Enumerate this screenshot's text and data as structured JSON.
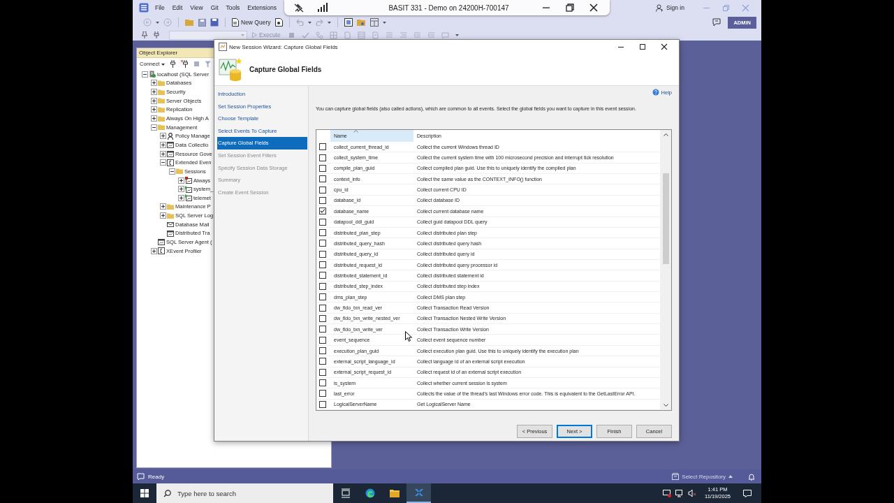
{
  "remote_bar": {
    "title": "BASIT 331 - Demo on 24200H-700147"
  },
  "menu_bar": {
    "items": [
      "File",
      "Edit",
      "View",
      "Git",
      "Tools",
      "Extensions"
    ],
    "sign_in": "Sign in"
  },
  "toolbar": {
    "new_query": "New Query",
    "execute": {
      "label": "Execute",
      "disabled": true
    },
    "account_badge": "ADMIN"
  },
  "object_explorer": {
    "title": "Object Explorer",
    "connect": "Connect",
    "tree": [
      {
        "label": "localhost (SQL Server",
        "kind": "server",
        "expanded": true,
        "children": [
          {
            "label": "Databases",
            "kind": "folder",
            "expanded": false
          },
          {
            "label": "Security",
            "kind": "folder",
            "expanded": false
          },
          {
            "label": "Server Objects",
            "kind": "folder",
            "expanded": false
          },
          {
            "label": "Replication",
            "kind": "folder",
            "expanded": false
          },
          {
            "label": "Always On High A",
            "kind": "folder",
            "expanded": false
          },
          {
            "label": "Management",
            "kind": "folder",
            "expanded": true,
            "children": [
              {
                "label": "Policy Manage",
                "kind": "policy",
                "expanded": false
              },
              {
                "label": "Data Collectio",
                "kind": "window",
                "expanded": false
              },
              {
                "label": "Resource Gove",
                "kind": "window",
                "expanded": false
              },
              {
                "label": "Extended Even",
                "kind": "bracket",
                "expanded": true,
                "children": [
                  {
                    "label": "Sessions",
                    "kind": "folder",
                    "expanded": true,
                    "children": [
                      {
                        "label": "Always",
                        "kind": "session",
                        "running": false,
                        "expanded": false
                      },
                      {
                        "label": "system_",
                        "kind": "session",
                        "running": true,
                        "expanded": false
                      },
                      {
                        "label": "telemet",
                        "kind": "session",
                        "running": true,
                        "expanded": false
                      }
                    ]
                  }
                ]
              },
              {
                "label": "Maintenance P",
                "kind": "folder",
                "expanded": false
              },
              {
                "label": "SQL Server Log",
                "kind": "folder",
                "expanded": false
              },
              {
                "label": "Database Mail",
                "kind": "mail"
              },
              {
                "label": "Distributed Tra",
                "kind": "window"
              }
            ]
          },
          {
            "label": "SQL Server Agent (",
            "kind": "window"
          },
          {
            "label": "XEvent Profiler",
            "kind": "bracket",
            "expanded": false
          }
        ]
      }
    ]
  },
  "wizard": {
    "title": "New Session Wizard: Capture Global Fields",
    "heading": "Capture Global Fields",
    "steps": [
      {
        "label": "Introduction",
        "selected": false,
        "disabled": false
      },
      {
        "label": "Set Session Properties",
        "selected": false,
        "disabled": false
      },
      {
        "label": "Choose Template",
        "selected": false,
        "disabled": false
      },
      {
        "label": "Select Events To Capture",
        "selected": false,
        "disabled": false
      },
      {
        "label": "Capture Global Fields",
        "selected": true,
        "disabled": false
      },
      {
        "label": "Set Session Event Filters",
        "selected": false,
        "disabled": true
      },
      {
        "label": "Specify Session Data Storage",
        "selected": false,
        "disabled": true
      },
      {
        "label": "Summary",
        "selected": false,
        "disabled": true
      },
      {
        "label": "Create Event Session",
        "selected": false,
        "disabled": true
      }
    ],
    "help": "Help",
    "description": "You can capture global fields (also called actions), which are common to all events. Select the global fields you want to capture in this event session.",
    "table": {
      "columns": [
        "Name",
        "Description"
      ],
      "rows": [
        {
          "name": "collect_current_thread_id",
          "description": "Collect the current Windows thread ID",
          "checked": false
        },
        {
          "name": "collect_system_time",
          "description": "Collect the current system time with 100 microsecond precision and interrupt tick resolution",
          "checked": false
        },
        {
          "name": "compile_plan_guid",
          "description": "Collect compiled plan guid. Use this to uniquely identify the compiled plan",
          "checked": false
        },
        {
          "name": "context_info",
          "description": "Collect the same value as the CONTEXT_INFO() function",
          "checked": false
        },
        {
          "name": "cpu_id",
          "description": "Collect current CPU ID",
          "checked": false
        },
        {
          "name": "database_id",
          "description": "Collect database ID",
          "checked": false
        },
        {
          "name": "database_name",
          "description": "Collect current database name",
          "checked": true
        },
        {
          "name": "datapool_ddl_guid",
          "description": "Collect guid datapool DDL query",
          "checked": false
        },
        {
          "name": "distributed_plan_step",
          "description": "Collect distributed plan step",
          "checked": false
        },
        {
          "name": "distributed_query_hash",
          "description": "Collect distributed query hash",
          "checked": false
        },
        {
          "name": "distributed_query_id",
          "description": "Collect distributed query id",
          "checked": false
        },
        {
          "name": "distributed_request_id",
          "description": "Collect distributed query processor id",
          "checked": false
        },
        {
          "name": "distributed_statement_id",
          "description": "Collect distributed statement id",
          "checked": false
        },
        {
          "name": "distributed_step_index",
          "description": "Collect distributed step index",
          "checked": false
        },
        {
          "name": "dms_plan_step",
          "description": "Collect DMS plan step",
          "checked": false
        },
        {
          "name": "dw_fido_txn_read_ver",
          "description": "Collect Transaction Read Version",
          "checked": false
        },
        {
          "name": "dw_fido_txn_write_nested_ver",
          "description": "Collect Transaction Nested Write Version",
          "checked": false
        },
        {
          "name": "dw_fido_txn_write_ver",
          "description": "Collect Transaction Write Version",
          "checked": false
        },
        {
          "name": "event_sequence",
          "description": "Collect event sequence number",
          "checked": false
        },
        {
          "name": "execution_plan_guid",
          "description": "Collect execution plan guid. Use this to uniquely identify the execution plan",
          "checked": false
        },
        {
          "name": "external_script_language_id",
          "description": "Collect language id of an external script execution",
          "checked": false
        },
        {
          "name": "external_script_request_id",
          "description": "Collect request id of an external script execution",
          "checked": false
        },
        {
          "name": "is_system",
          "description": "Collect whether current session is system",
          "checked": false
        },
        {
          "name": "last_error",
          "description": "Collects the value of the thread's last Windows error code. This is equivalent to the GetLastError API.",
          "checked": false
        },
        {
          "name": "LogicalServerName",
          "description": "Get LogicalServer Name",
          "checked": false
        }
      ]
    },
    "buttons": [
      {
        "label": "< Previous",
        "default": false
      },
      {
        "label": "Next >",
        "default": true
      },
      {
        "label": "Finish",
        "default": false
      },
      {
        "label": "Cancel",
        "default": false
      }
    ]
  },
  "status_bar": {
    "text": "Ready",
    "repository": "Select Repository"
  },
  "taskbar": {
    "search": {
      "placeholder": "Type here to search"
    },
    "time": "1:41 PM",
    "date": "11/19/2025"
  }
}
